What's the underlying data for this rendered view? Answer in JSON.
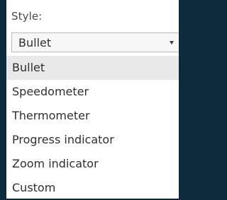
{
  "style_field": {
    "label": "Style:",
    "selected_value": "Bullet",
    "dropdown_icon": "caret-down-icon",
    "options": [
      {
        "label": "Bullet",
        "selected": true
      },
      {
        "label": "Speedometer",
        "selected": false
      },
      {
        "label": "Thermometer",
        "selected": false
      },
      {
        "label": "Progress indicator",
        "selected": false
      },
      {
        "label": "Zoom indicator",
        "selected": false
      },
      {
        "label": "Custom",
        "selected": false
      }
    ]
  },
  "colors": {
    "page_background": "#0c2b3d",
    "panel_background": "#ffffff",
    "selected_option_background": "#e9e9e9",
    "select_border": "#b9b9b9"
  }
}
